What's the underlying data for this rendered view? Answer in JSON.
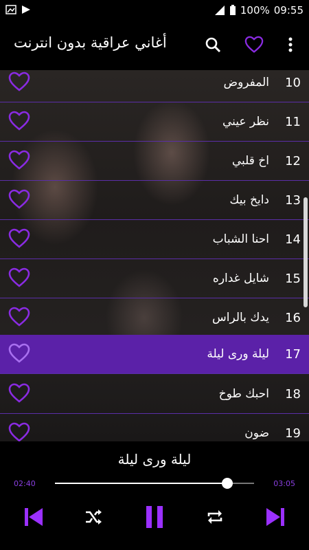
{
  "status": {
    "battery": "100%",
    "time": "09:55"
  },
  "appbar": {
    "title": "أغاني عراقية بدون انترنت"
  },
  "list": {
    "rows": [
      {
        "num": "10",
        "title": "المفروض"
      },
      {
        "num": "11",
        "title": "نظر عيني"
      },
      {
        "num": "12",
        "title": "اخ قلبي"
      },
      {
        "num": "13",
        "title": "دايخ بيك"
      },
      {
        "num": "14",
        "title": "احنا الشباب"
      },
      {
        "num": "15",
        "title": "شايل غداره"
      },
      {
        "num": "16",
        "title": "يدك بالراس"
      },
      {
        "num": "17",
        "title": "ليلة ورى ليلة"
      },
      {
        "num": "18",
        "title": "احبك طوخ"
      },
      {
        "num": "19",
        "title": "ضون"
      }
    ],
    "active_index": 7
  },
  "player": {
    "now_playing": "ليلة ورى ليلة",
    "current_time": "02:40",
    "total_time": "03:05",
    "progress_fraction": 0.865
  },
  "colors": {
    "accent": "#8a2be2",
    "active_row": "#5b21a8",
    "divider": "#5b2ea8"
  },
  "icons": [
    "search-icon",
    "heart-icon",
    "more-vert-icon",
    "previous-icon",
    "shuffle-icon",
    "pause-icon",
    "repeat-icon",
    "next-icon"
  ]
}
